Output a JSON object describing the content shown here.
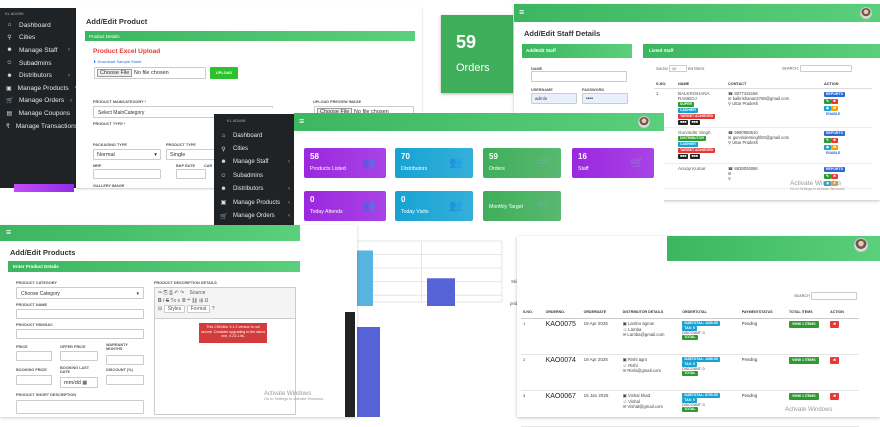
{
  "brand": "KL ADMIN",
  "nav": [
    {
      "label": "Dashboard",
      "icon": "home-icon",
      "chev": false
    },
    {
      "label": "Cities",
      "icon": "pin-icon",
      "chev": false
    },
    {
      "label": "Manage Staff",
      "icon": "users-icon",
      "chev": true
    },
    {
      "label": "Subadmins",
      "icon": "user-icon",
      "chev": false
    },
    {
      "label": "Distributors",
      "icon": "users-icon",
      "chev": true
    },
    {
      "label": "Manage Products",
      "icon": "box-icon",
      "chev": true
    },
    {
      "label": "Manage Orders",
      "icon": "cart-icon",
      "chev": true
    },
    {
      "label": "Manage Coupons",
      "icon": "ticket-icon",
      "chev": false
    },
    {
      "label": "Manage Transactions",
      "icon": "rupee-icon",
      "chev": false
    }
  ],
  "product_form": {
    "title": "Add/Edit Product",
    "bar": "Product Details",
    "excel_title": "Product Excel Upload",
    "sample_link": "Download Sample Sheet",
    "choose_file": "Choose File",
    "no_file": "No file chosen",
    "upload": "UPLOAD",
    "main_category": "PRODUCT MAINCATEGORY *",
    "main_category_value": "Select MainCategory",
    "upload_preview": "UPLOAD PREVIEW IMAGE",
    "product_type": "PRODUCT TYPE *",
    "packaging_type": "PACKAGING TYPE",
    "packaging_value": "Normal",
    "product_type2": "PRODUCT TYPE",
    "product_type2_value": "Single",
    "mrp": "MRP",
    "bkp_rate": "BKP RATE",
    "cart": "CAR",
    "gallery": "GALLERY IMAGE"
  },
  "orders_widget": {
    "count": "59",
    "label": "Orders"
  },
  "staff": {
    "title": "Add/Edit Staff Details",
    "add_bar": "Add/Edit Staff",
    "list_bar": "Listed Staff",
    "name_lbl": "NAME",
    "user_lbl": "USERNAME",
    "pass_lbl": "PASSWORD",
    "user_val": "admin",
    "pass_val": "••••",
    "show": "SHOW",
    "show_val": "10",
    "entries": "ENTRIES",
    "search": "SEARCH:",
    "cols": [
      "S.NO.",
      "NAME",
      "CONTACT",
      "ACTION"
    ],
    "rows": [
      {
        "sno": "1",
        "name": "BALKRISHANA RAMBOJ",
        "phone": "8077415156",
        "email": "balkrishanan2769@gmail.com",
        "loc": "Uttar Pradesh",
        "tags": [
          "SUPER",
          "CASHIER",
          "TARGET ACHIEVED"
        ]
      },
      {
        "sno": "2",
        "name": "Gurvinder Singh",
        "phone": "9690958510",
        "email": "gurvindersinghl03@gmail.com",
        "loc": "Uttar Pradesh",
        "tags": [
          "DISTRIBUTOR",
          "CASHIER",
          "TARGET ACHIEVED"
        ]
      },
      {
        "sno": "3",
        "name": "Anoop Kumar",
        "phone": "8638026066",
        "email": "",
        "loc": "",
        "tags": []
      }
    ],
    "actions": [
      "REPORTS",
      "EDIT"
    ],
    "windows": "Activate Windows",
    "windows_sub": "Go to Settings to activate Windows."
  },
  "dashboard": {
    "brand": "KL ADMIN",
    "cards": [
      {
        "num": "58",
        "label": "Products Listed",
        "color": "#9b27e0",
        "icon": "group-icon"
      },
      {
        "num": "70",
        "label": "Distributors",
        "color": "#16a3d3",
        "icon": "group-icon"
      },
      {
        "num": "59",
        "label": "Orders",
        "color": "#3fae5a",
        "icon": "cart-icon"
      },
      {
        "num": "16",
        "label": "Staff",
        "color": "#9b27e0",
        "icon": "cart-icon"
      },
      {
        "num": "0",
        "label": "Today Attends",
        "color": "#9b27e0",
        "icon": "group-icon"
      },
      {
        "num": "0",
        "label": "Today Visits",
        "color": "#16a3d3",
        "icon": "group-icon"
      },
      {
        "num": "",
        "label": "Monthly Target",
        "color": "#3fae5a",
        "icon": "cart-icon"
      }
    ]
  },
  "chart_data": [
    {
      "type": "bar",
      "categories": [
        "",
        ""
      ],
      "values": [
        12600000,
        8500000
      ],
      "ylim": [
        5000000,
        14000000
      ],
      "yticks": [
        "14,000,000",
        "12,000,000",
        "10,000,000",
        "8,000,000",
        "6,000,000",
        "5,000,000"
      ]
    },
    {
      "type": "pie",
      "labels": [
        "BIG: 6.79%",
        "PQR: 16.49%",
        "Skides: 0.55%",
        "prides: 16.68%",
        "InsecKide: 45"
      ],
      "values": [
        6.79,
        16.49,
        0.55,
        16.68,
        59.49
      ]
    }
  ],
  "add_product2": {
    "title": "Add/Edit Products",
    "bar": "Enter Product Details",
    "category": "PRODUCT CATEGORY",
    "category_value": "Choose Category",
    "desc": "PRODUCT DESCRIPTION DETAILS",
    "name": "PRODUCT NAME",
    "hsn": "PRODUCT HSN/SAC",
    "price": "PRICE",
    "offer": "OFFER PRICE",
    "warranty": "WARRANTY MONTHS",
    "booking": "BOOKING PRICE",
    "booking_last": "BOOKING LAST DATE",
    "discount": "DISCOUNT (%)",
    "short": "PRODUCT SHORT DESCRIPTION",
    "date_val": "mm/dd",
    "toolbar_styles": "Styles",
    "toolbar_format": "Format",
    "source": "Source",
    "warning": "This CKEditor 4.1.2 version is not secure. Consider upgrading to the latest one, 4.24.1-lts.",
    "windows": "Activate Windows",
    "windows_sub": "Go to Settings to activate Windows."
  },
  "orders_table": {
    "search": "SEARCH",
    "cols": [
      "S.NO.",
      "ORDERNO.",
      "ORDERDATE",
      "DISTRIBUTOR DETAILS",
      "ORDERTOTAL",
      "PAYMENTSTATUS",
      "TOTAL ITEMS",
      "ACTION"
    ],
    "rows": [
      {
        "sno": "1",
        "no": "KAO0075",
        "date": "19 Apr 2025",
        "dist": "Lambo agrow",
        "dist2": "Lamba",
        "email": "Lamba@gmail.com",
        "total": "SUBTOTAL: 1200.00",
        "status": "Pending"
      },
      {
        "sno": "2",
        "no": "KAO0074",
        "date": "19 Apr 2025",
        "dist": "Rishi agro",
        "dist2": "Rishi",
        "email": "Rishi@gmail.com",
        "total": "SUBTOTAL: 1260.00",
        "status": "Pending"
      },
      {
        "sno": "3",
        "no": "KAO0067",
        "date": "15 Jan 2025",
        "dist": "Vishal khad",
        "dist2": "Vishal",
        "email": "Vishal@gmail.com",
        "total": "SUBTOTAL: 8700.00",
        "status": "Pending"
      }
    ],
    "tax": "TAX: 0",
    "discount": "DISCOUNT: 0",
    "grand": "TOTAL",
    "view": "VIEW 1 ITEMS",
    "windows": "Activate Windows"
  }
}
